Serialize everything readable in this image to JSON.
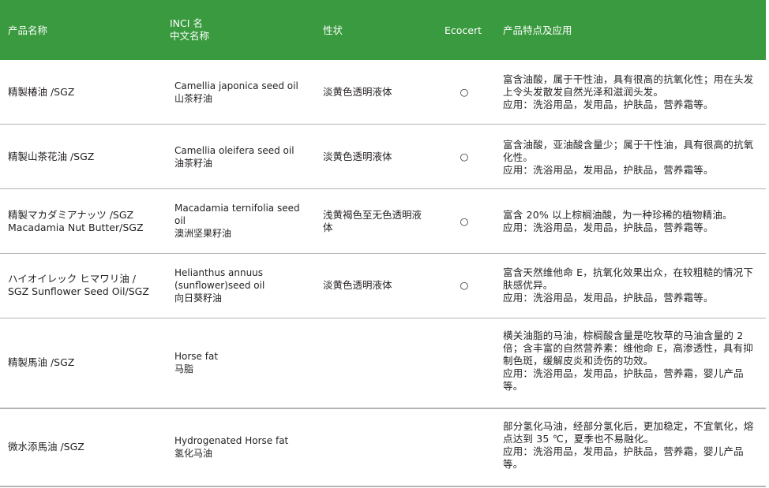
{
  "header": {
    "col_name": "产品名称",
    "col_inci": "INCI 名\n中文名称",
    "col_prop": "性状",
    "col_eco": "Ecocert",
    "col_feat": "产品特点及应用"
  },
  "rows": [
    {
      "name": "精製椿油 /SGZ",
      "inci": "Camellia japonica seed oil\n山茶籽油",
      "prop": "淡黄色透明液体",
      "eco": "○",
      "feat": "富含油酸，属于干性油，具有很高的抗氧化性；用在头发上令头发散发自然光泽和滋润头发。\n应用：洗浴用品，发用品，护肤品，营养霜等。"
    },
    {
      "name": "精製山茶花油 /SGZ",
      "inci": "Camellia oleifera seed oil\n油茶籽油",
      "prop": "淡黄色透明液体",
      "eco": "○",
      "feat": "富含油酸，亚油酸含量少；属于干性油，具有很高的抗氧化性。\n应用：洗浴用品，发用品，护肤品，营养霜等。"
    },
    {
      "name": "精製マカダミアナッツ /SGZ\nMacadamia Nut Butter/SGZ",
      "inci": "Macadamia ternifolia seed oil\n澳洲坚果籽油",
      "prop": "浅黄褐色至无色透明液体",
      "eco": "○",
      "feat": "富含 20% 以上棕榈油酸，为一种珍稀的植物精油。\n应用：洗浴用品，发用品，护肤品，营养霜等。"
    },
    {
      "name": "ハイオイレック ヒマワリ油 /\nSGZ Sunflower Seed Oil/SGZ",
      "inci": "Helianthus annuus\n(sunflower)seed oil\n向日葵籽油",
      "prop": "淡黄色透明液体",
      "eco": "○",
      "feat": "富含天然维他命 E，抗氧化效果出众，在较粗糙的情况下肤感优异。\n应用：洗浴用品，发用品，护肤品，营养霜等。"
    },
    {
      "name": "精製馬油 /SGZ",
      "inci": "Horse fat\n马脂",
      "prop": "",
      "eco": "",
      "feat": "横关油脂的马油，棕榈酸含量是吃牧草的马油含量的 2 倍；含丰富的自然营养素：维他命 E，高渗透性，具有抑制色斑，缓解皮炎和烫伤的功效。\n应用：洗浴用品，发用品，护肤品，营养霜，婴儿产品等。"
    },
    {
      "name": "微水添馬油 /SGZ",
      "inci": "Hydrogenated Horse fat\n氢化马油",
      "prop": "",
      "eco": "",
      "feat": "部分氢化马油，经部分氢化后，更加稳定，不宜氧化，熔点达到 35 ℃，夏季也不易融化。\n应用：洗浴用品，发用品，护肤品，营养霜，婴儿产品等。"
    }
  ]
}
